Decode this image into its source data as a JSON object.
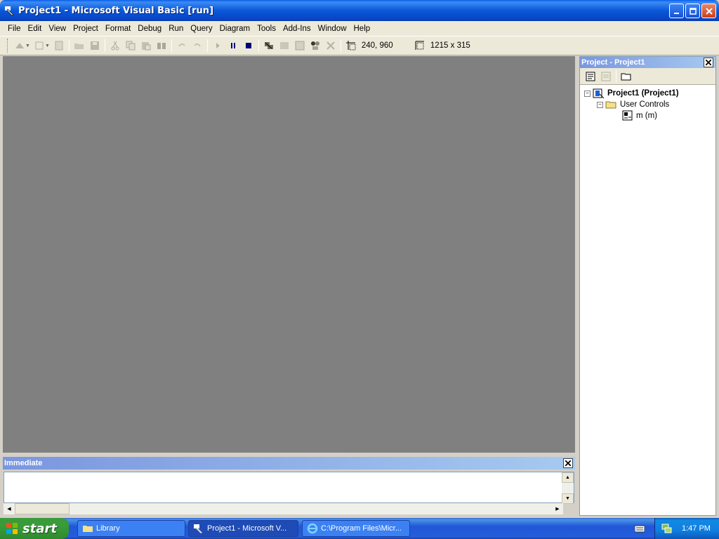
{
  "window": {
    "title": "Project1 - Microsoft Visual Basic [run]"
  },
  "menu": [
    "File",
    "Edit",
    "View",
    "Project",
    "Format",
    "Debug",
    "Run",
    "Query",
    "Diagram",
    "Tools",
    "Add-Ins",
    "Window",
    "Help"
  ],
  "toolbar": {
    "position": "240, 960",
    "size": "1215 x 315"
  },
  "immediate": {
    "title": "Immediate"
  },
  "project": {
    "title": "Project - Project1",
    "root": "Project1 (Project1)",
    "folder": "User Controls",
    "item": "m (m)"
  },
  "taskbar": {
    "start": "start",
    "tasks": [
      "Library",
      "Project1 - Microsoft V...",
      "C:\\Program Files\\Micr..."
    ],
    "clock": "1:47 PM"
  },
  "colors": {
    "workspace": "#808080",
    "titlebar": "#0a58d8",
    "panel_title": "#7a96df"
  }
}
